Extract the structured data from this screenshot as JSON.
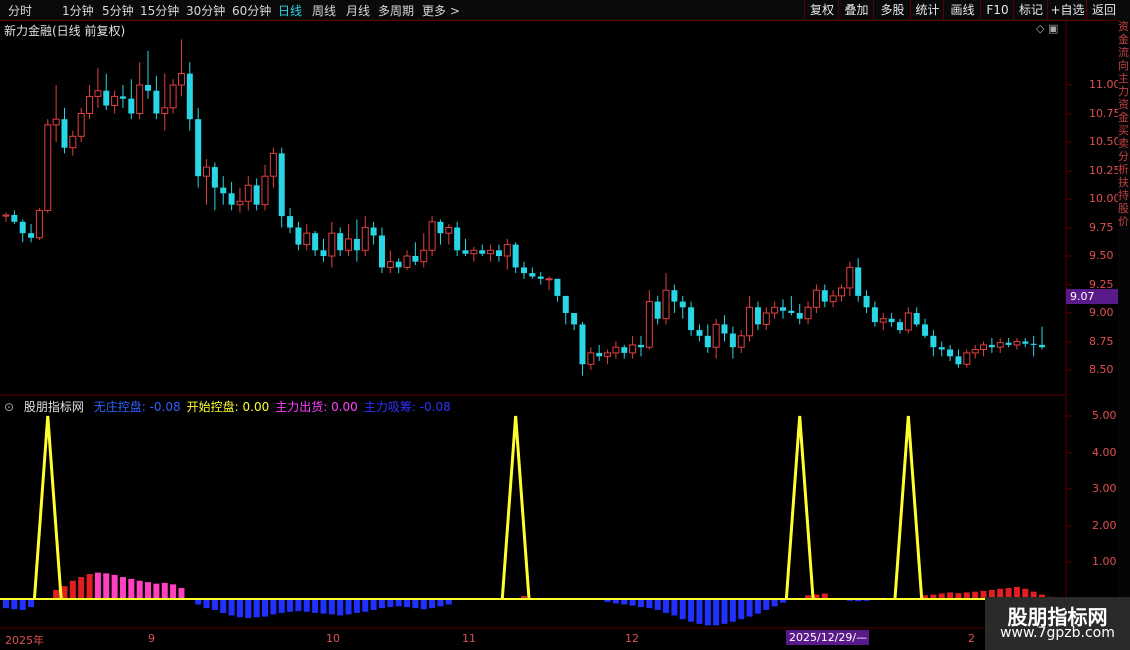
{
  "toolbar": {
    "periods": [
      "分时",
      "1分钟",
      "5分钟",
      "15分钟",
      "30分钟",
      "60分钟",
      "日线",
      "周线",
      "月线",
      "多周期",
      "更多 >"
    ],
    "active_period": "日线",
    "actions": [
      "复权",
      "叠加",
      "多股",
      "统计",
      "画线",
      "F10",
      "标记",
      "+自选",
      "返回"
    ]
  },
  "chart": {
    "title": "新力金融(日线 前复权)",
    "price_axis_labels": [
      "11.00",
      "10.75",
      "10.50",
      "10.25",
      "10.00",
      "9.75",
      "9.50",
      "9.25",
      "9.00",
      "8.75",
      "8.50"
    ],
    "current_price": "9.07",
    "icons": [
      "diamond-icon",
      "window-icon"
    ]
  },
  "indicator": {
    "name": "股朋指标网",
    "legend": [
      {
        "label": "无庄控盘:",
        "value": "-0.08",
        "color": "#3060ff"
      },
      {
        "label": "开始控盘:",
        "value": "0.00",
        "color": "#ffff30"
      },
      {
        "label": "主力出货:",
        "value": "0.00",
        "color": "#ff40ff"
      },
      {
        "label": "主力吸筹:",
        "value": "-0.08",
        "color": "#3030ff"
      }
    ],
    "axis_labels": [
      "5.00",
      "4.00",
      "3.00",
      "2.00",
      "1.00"
    ]
  },
  "dates": {
    "labels": [
      "2025年",
      "9",
      "10",
      "11",
      "12",
      "2"
    ],
    "highlight": "2025/12/29/—"
  },
  "watermark": {
    "title": "股朋指标网",
    "url": "www.7gpzb.com"
  },
  "right_strip": "资金流向主力资金买卖分析扶持股价",
  "colors": {
    "up": "#e04040",
    "down": "#29d6e6",
    "grid": "#5a0000",
    "spike": "#ffff30"
  },
  "chart_data": {
    "type": "candlestick",
    "candles": [
      [
        9.85,
        9.88,
        9.8,
        9.86
      ],
      [
        9.86,
        9.9,
        9.78,
        9.8
      ],
      [
        9.8,
        9.82,
        9.62,
        9.7
      ],
      [
        9.7,
        9.78,
        9.62,
        9.66
      ],
      [
        9.66,
        9.92,
        9.64,
        9.9
      ],
      [
        9.9,
        10.7,
        9.88,
        10.65
      ],
      [
        10.65,
        11.0,
        10.5,
        10.7
      ],
      [
        10.7,
        10.8,
        10.4,
        10.45
      ],
      [
        10.45,
        10.6,
        10.38,
        10.55
      ],
      [
        10.55,
        10.8,
        10.5,
        10.75
      ],
      [
        10.75,
        11.0,
        10.7,
        10.9
      ],
      [
        10.9,
        11.15,
        10.8,
        10.95
      ],
      [
        10.95,
        11.1,
        10.78,
        10.82
      ],
      [
        10.82,
        10.95,
        10.75,
        10.9
      ],
      [
        10.9,
        11.0,
        10.8,
        10.88
      ],
      [
        10.88,
        11.05,
        10.7,
        10.75
      ],
      [
        10.75,
        11.2,
        10.7,
        11.0
      ],
      [
        11.0,
        11.3,
        10.88,
        10.95
      ],
      [
        10.95,
        11.08,
        10.7,
        10.75
      ],
      [
        10.75,
        11.1,
        10.6,
        10.8
      ],
      [
        10.8,
        11.05,
        10.75,
        11.0
      ],
      [
        11.0,
        11.4,
        10.9,
        11.1
      ],
      [
        11.1,
        11.2,
        10.6,
        10.7
      ],
      [
        10.7,
        10.8,
        10.1,
        10.2
      ],
      [
        10.2,
        10.35,
        9.95,
        10.28
      ],
      [
        10.28,
        10.32,
        9.9,
        10.1
      ],
      [
        10.1,
        10.2,
        9.95,
        10.05
      ],
      [
        10.05,
        10.15,
        9.9,
        9.95
      ],
      [
        9.95,
        10.1,
        9.88,
        9.98
      ],
      [
        9.98,
        10.2,
        9.9,
        10.12
      ],
      [
        10.12,
        10.18,
        9.9,
        9.95
      ],
      [
        9.95,
        10.3,
        9.9,
        10.2
      ],
      [
        10.2,
        10.45,
        10.1,
        10.4
      ],
      [
        10.4,
        10.45,
        9.75,
        9.85
      ],
      [
        9.85,
        9.92,
        9.7,
        9.75
      ],
      [
        9.75,
        9.8,
        9.55,
        9.6
      ],
      [
        9.6,
        9.78,
        9.55,
        9.7
      ],
      [
        9.7,
        9.72,
        9.5,
        9.55
      ],
      [
        9.55,
        9.65,
        9.45,
        9.5
      ],
      [
        9.5,
        9.8,
        9.4,
        9.7
      ],
      [
        9.7,
        9.75,
        9.5,
        9.55
      ],
      [
        9.55,
        9.78,
        9.5,
        9.65
      ],
      [
        9.65,
        9.82,
        9.45,
        9.55
      ],
      [
        9.55,
        9.85,
        9.5,
        9.75
      ],
      [
        9.75,
        9.8,
        9.6,
        9.68
      ],
      [
        9.68,
        9.75,
        9.35,
        9.4
      ],
      [
        9.4,
        9.55,
        9.35,
        9.45
      ],
      [
        9.45,
        9.48,
        9.35,
        9.4
      ],
      [
        9.4,
        9.55,
        9.38,
        9.5
      ],
      [
        9.5,
        9.62,
        9.42,
        9.45
      ],
      [
        9.45,
        9.7,
        9.4,
        9.55
      ],
      [
        9.55,
        9.85,
        9.5,
        9.8
      ],
      [
        9.8,
        9.82,
        9.6,
        9.7
      ],
      [
        9.7,
        9.78,
        9.6,
        9.75
      ],
      [
        9.75,
        9.8,
        9.5,
        9.55
      ],
      [
        9.55,
        9.65,
        9.5,
        9.52
      ],
      [
        9.52,
        9.58,
        9.45,
        9.55
      ],
      [
        9.55,
        9.6,
        9.5,
        9.52
      ],
      [
        9.52,
        9.6,
        9.45,
        9.55
      ],
      [
        9.55,
        9.6,
        9.45,
        9.5
      ],
      [
        9.5,
        9.65,
        9.38,
        9.6
      ],
      [
        9.6,
        9.62,
        9.35,
        9.4
      ],
      [
        9.4,
        9.45,
        9.3,
        9.35
      ],
      [
        9.35,
        9.4,
        9.3,
        9.32
      ],
      [
        9.32,
        9.36,
        9.25,
        9.3
      ],
      [
        9.3,
        9.32,
        9.2,
        9.3
      ],
      [
        9.3,
        9.28,
        9.1,
        9.15
      ],
      [
        9.15,
        9.1,
        8.9,
        9.0
      ],
      [
        9.0,
        8.98,
        8.85,
        8.9
      ],
      [
        8.9,
        8.92,
        8.45,
        8.55
      ],
      [
        8.55,
        8.7,
        8.5,
        8.65
      ],
      [
        8.65,
        8.72,
        8.58,
        8.62
      ],
      [
        8.62,
        8.68,
        8.55,
        8.65
      ],
      [
        8.65,
        8.75,
        8.6,
        8.7
      ],
      [
        8.7,
        8.72,
        8.6,
        8.65
      ],
      [
        8.65,
        8.8,
        8.6,
        8.72
      ],
      [
        8.72,
        8.8,
        8.62,
        8.7
      ],
      [
        8.7,
        9.2,
        8.68,
        9.1
      ],
      [
        9.1,
        9.15,
        8.9,
        8.95
      ],
      [
        8.95,
        9.35,
        8.9,
        9.2
      ],
      [
        9.2,
        9.25,
        9.0,
        9.1
      ],
      [
        9.1,
        9.15,
        8.95,
        9.05
      ],
      [
        9.05,
        9.1,
        8.8,
        8.85
      ],
      [
        8.85,
        8.9,
        8.75,
        8.8
      ],
      [
        8.8,
        8.9,
        8.65,
        8.7
      ],
      [
        8.7,
        8.95,
        8.6,
        8.9
      ],
      [
        8.9,
        8.98,
        8.75,
        8.82
      ],
      [
        8.82,
        8.88,
        8.6,
        8.7
      ],
      [
        8.7,
        8.85,
        8.65,
        8.8
      ],
      [
        8.8,
        9.15,
        8.75,
        9.05
      ],
      [
        9.05,
        9.1,
        8.85,
        8.9
      ],
      [
        8.9,
        9.05,
        8.85,
        9.0
      ],
      [
        9.0,
        9.1,
        8.95,
        9.05
      ],
      [
        9.05,
        9.12,
        8.95,
        9.02
      ],
      [
        9.02,
        9.15,
        8.98,
        9.0
      ],
      [
        9.0,
        9.08,
        8.9,
        8.95
      ],
      [
        8.95,
        9.1,
        8.9,
        9.05
      ],
      [
        9.05,
        9.25,
        9.0,
        9.2
      ],
      [
        9.2,
        9.25,
        9.05,
        9.1
      ],
      [
        9.1,
        9.2,
        9.05,
        9.15
      ],
      [
        9.15,
        9.25,
        9.1,
        9.22
      ],
      [
        9.22,
        9.45,
        9.15,
        9.4
      ],
      [
        9.4,
        9.48,
        9.1,
        9.15
      ],
      [
        9.15,
        9.2,
        9.0,
        9.05
      ],
      [
        9.05,
        9.1,
        8.88,
        8.92
      ],
      [
        8.92,
        9.0,
        8.85,
        8.95
      ],
      [
        8.95,
        9.0,
        8.88,
        8.92
      ],
      [
        8.92,
        8.95,
        8.82,
        8.85
      ],
      [
        8.85,
        9.05,
        8.82,
        9.0
      ],
      [
        9.0,
        9.05,
        8.88,
        8.9
      ],
      [
        8.9,
        8.95,
        8.78,
        8.8
      ],
      [
        8.8,
        8.85,
        8.62,
        8.7
      ],
      [
        8.7,
        8.75,
        8.62,
        8.68
      ],
      [
        8.68,
        8.72,
        8.58,
        8.62
      ],
      [
        8.62,
        8.68,
        8.52,
        8.55
      ],
      [
        8.55,
        8.68,
        8.52,
        8.65
      ],
      [
        8.65,
        8.72,
        8.6,
        8.68
      ],
      [
        8.68,
        8.75,
        8.62,
        8.72
      ],
      [
        8.72,
        8.78,
        8.65,
        8.7
      ],
      [
        8.7,
        8.78,
        8.65,
        8.74
      ],
      [
        8.74,
        8.78,
        8.7,
        8.72
      ],
      [
        8.72,
        8.78,
        8.68,
        8.75
      ],
      [
        8.75,
        8.78,
        8.7,
        8.73
      ],
      [
        8.73,
        8.8,
        8.62,
        8.72
      ],
      [
        8.72,
        8.88,
        8.68,
        8.7
      ]
    ],
    "y_range": [
      8.4,
      11.5
    ],
    "indicator_range": [
      -0.8,
      5.2
    ],
    "spikes_at": [
      5,
      61,
      95,
      108
    ],
    "spike_value": 5.0,
    "red_bars": [
      [
        6,
        0.25
      ],
      [
        7,
        0.35
      ],
      [
        8,
        0.5
      ],
      [
        9,
        0.6
      ],
      [
        10,
        0.68
      ],
      [
        11,
        0.72
      ],
      [
        12,
        0.7
      ],
      [
        13,
        0.66
      ],
      [
        14,
        0.6
      ],
      [
        15,
        0.55
      ],
      [
        16,
        0.5
      ],
      [
        17,
        0.46
      ],
      [
        18,
        0.42
      ],
      [
        19,
        0.44
      ],
      [
        20,
        0.4
      ],
      [
        21,
        0.3
      ],
      [
        62,
        0.08
      ],
      [
        96,
        0.1
      ],
      [
        97,
        0.12
      ],
      [
        98,
        0.15
      ],
      [
        110,
        0.1
      ],
      [
        111,
        0.12
      ],
      [
        112,
        0.15
      ],
      [
        113,
        0.18
      ],
      [
        114,
        0.16
      ],
      [
        115,
        0.18
      ],
      [
        116,
        0.2
      ],
      [
        117,
        0.22
      ],
      [
        118,
        0.25
      ],
      [
        119,
        0.28
      ],
      [
        120,
        0.3
      ],
      [
        121,
        0.33
      ],
      [
        122,
        0.28
      ],
      [
        123,
        0.2
      ],
      [
        124,
        0.12
      ],
      [
        125,
        0.06
      ]
    ],
    "blue_bars": [
      [
        0,
        -0.25
      ],
      [
        1,
        -0.28
      ],
      [
        2,
        -0.3
      ],
      [
        3,
        -0.22
      ],
      [
        23,
        -0.15
      ],
      [
        24,
        -0.25
      ],
      [
        25,
        -0.3
      ],
      [
        26,
        -0.38
      ],
      [
        27,
        -0.45
      ],
      [
        28,
        -0.5
      ],
      [
        29,
        -0.52
      ],
      [
        30,
        -0.5
      ],
      [
        31,
        -0.48
      ],
      [
        32,
        -0.42
      ],
      [
        33,
        -0.38
      ],
      [
        34,
        -0.35
      ],
      [
        35,
        -0.33
      ],
      [
        36,
        -0.35
      ],
      [
        37,
        -0.38
      ],
      [
        38,
        -0.4
      ],
      [
        39,
        -0.42
      ],
      [
        40,
        -0.45
      ],
      [
        41,
        -0.42
      ],
      [
        42,
        -0.38
      ],
      [
        43,
        -0.35
      ],
      [
        44,
        -0.3
      ],
      [
        45,
        -0.25
      ],
      [
        46,
        -0.22
      ],
      [
        47,
        -0.2
      ],
      [
        48,
        -0.22
      ],
      [
        49,
        -0.25
      ],
      [
        50,
        -0.28
      ],
      [
        51,
        -0.25
      ],
      [
        52,
        -0.2
      ],
      [
        53,
        -0.15
      ],
      [
        72,
        -0.08
      ],
      [
        73,
        -0.12
      ],
      [
        74,
        -0.15
      ],
      [
        75,
        -0.18
      ],
      [
        76,
        -0.22
      ],
      [
        77,
        -0.25
      ],
      [
        78,
        -0.3
      ],
      [
        79,
        -0.38
      ],
      [
        80,
        -0.45
      ],
      [
        81,
        -0.55
      ],
      [
        82,
        -0.62
      ],
      [
        83,
        -0.68
      ],
      [
        84,
        -0.72
      ],
      [
        85,
        -0.72
      ],
      [
        86,
        -0.68
      ],
      [
        87,
        -0.62
      ],
      [
        88,
        -0.55
      ],
      [
        89,
        -0.48
      ],
      [
        90,
        -0.4
      ],
      [
        91,
        -0.3
      ],
      [
        92,
        -0.2
      ],
      [
        93,
        -0.1
      ],
      [
        101,
        -0.05
      ],
      [
        102,
        -0.06
      ],
      [
        103,
        -0.05
      ],
      [
        133,
        -0.08
      ],
      [
        134,
        -0.12
      ],
      [
        135,
        -0.15
      ],
      [
        136,
        -0.18
      ],
      [
        137,
        -0.2
      ],
      [
        138,
        -0.22
      ],
      [
        139,
        -0.25
      ],
      [
        140,
        -0.28
      ],
      [
        141,
        -0.3
      ],
      [
        142,
        -0.28
      ]
    ]
  }
}
